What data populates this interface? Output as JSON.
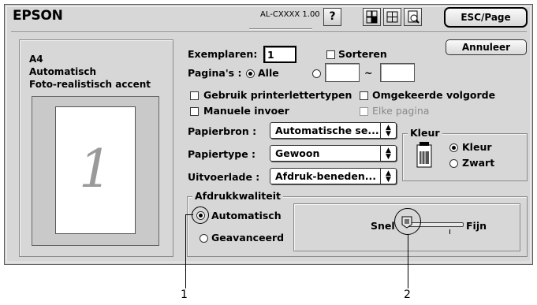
{
  "header": {
    "brand": "EPSON",
    "model": "AL-CXXXX 1.00",
    "help_icon_label": "?",
    "esc_page_label": "ESC/Page",
    "annuleer_label": "Annuleer"
  },
  "summary": {
    "line1": "A4",
    "line2": "Automatisch",
    "line3": "Foto-realistisch accent",
    "page_number": "1"
  },
  "copies": {
    "label": "Exemplaren:",
    "value": "1",
    "collate_label": "Sorteren"
  },
  "pages": {
    "label": "Pagina's :",
    "all_label": "Alle",
    "range_separator": "~",
    "from_value": "",
    "to_value": ""
  },
  "options": {
    "printer_fonts_label": "Gebruik printerlettertypen",
    "reverse_order_label": "Omgekeerde volgorde",
    "manual_feed_label": "Manuele invoer",
    "each_page_label": "Elke pagina"
  },
  "paper": {
    "source_label": "Papierbron :",
    "source_value": "Automatische se...",
    "type_label": "Papiertype :",
    "type_value": "Gewoon",
    "output_label": "Uitvoerlade :",
    "output_value": "Afdruk-beneden..."
  },
  "color": {
    "group_label": "Kleur",
    "color_label": "Kleur",
    "bw_label": "Zwart"
  },
  "quality": {
    "group_label": "Afdrukkwaliteit",
    "auto_label": "Automatisch",
    "advanced_label": "Geavanceerd",
    "slider_left_label": "Snel",
    "slider_right_label": "Fijn"
  },
  "callouts": {
    "one": "1",
    "two": "2"
  }
}
